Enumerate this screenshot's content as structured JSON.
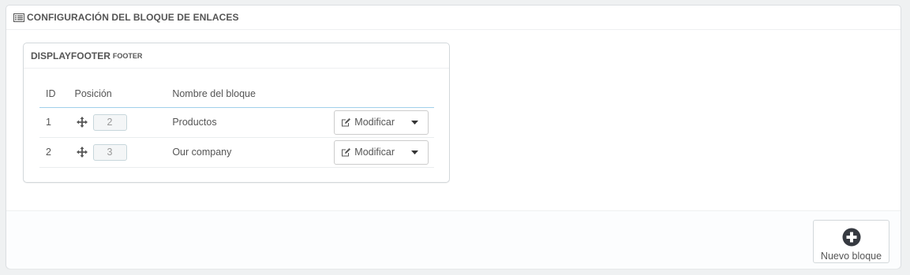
{
  "panel": {
    "title": "CONFIGURACIÓN DEL BLOQUE DE ENLACES",
    "icon": "list-alt-icon"
  },
  "hook_panel": {
    "title": "DISPLAYFOOTER",
    "subtitle": "FOOTER",
    "table": {
      "headers": [
        "ID",
        "Posición",
        "Nombre del bloque"
      ],
      "rows": [
        {
          "id": "1",
          "position": "2",
          "name": "Productos",
          "action": "Modificar"
        },
        {
          "id": "2",
          "position": "3",
          "name": "Our company",
          "action": "Modificar"
        }
      ]
    }
  },
  "footer": {
    "new_button_label": "Nuevo bloque",
    "new_button_icon": "plus-circle-icon"
  },
  "colors": {
    "background": "#eff1f2",
    "header_border": "#a0d0eb",
    "text": "#555555"
  }
}
